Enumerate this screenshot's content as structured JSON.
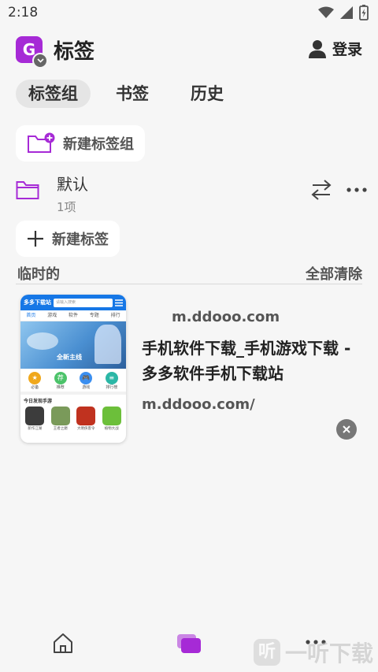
{
  "status": {
    "time": "2:18"
  },
  "header": {
    "avatar_letter": "G",
    "title": "标签",
    "login": "登录"
  },
  "tabs": [
    {
      "label": "标签组",
      "active": true
    },
    {
      "label": "书签"
    },
    {
      "label": "历史"
    }
  ],
  "new_group": "新建标签组",
  "group": {
    "name": "默认",
    "count": "1项"
  },
  "new_tab": "新建标签",
  "section": {
    "title": "临时的",
    "clear_all": "全部清除"
  },
  "card": {
    "domain": "m.ddooo.com",
    "title": "手机软件下载_手机游戏下载 - 多多软件手机下载站",
    "url": "m.ddooo.com/",
    "thumbnail": {
      "site_name": "多多下载站",
      "search_placeholder": "请输入搜索",
      "nav": [
        "首页",
        "游戏",
        "软件",
        "专题",
        "排行"
      ],
      "banner_text": "全新主线",
      "circles": [
        {
          "label": "必备",
          "glyph": "★"
        },
        {
          "label": "推荐",
          "glyph": "荐"
        },
        {
          "label": "游戏",
          "glyph": "🎮"
        },
        {
          "label": "排行榜",
          "glyph": "≡"
        }
      ],
      "section": "今日发现手游",
      "apps": [
        "新作江湖",
        "王者之巅",
        "大明侠客令",
        "植物大战"
      ]
    }
  },
  "colors": {
    "accent": "#a62ad6",
    "background": "#f6f6f6"
  },
  "watermark": {
    "text": "一听下载",
    "glyph": "听"
  }
}
